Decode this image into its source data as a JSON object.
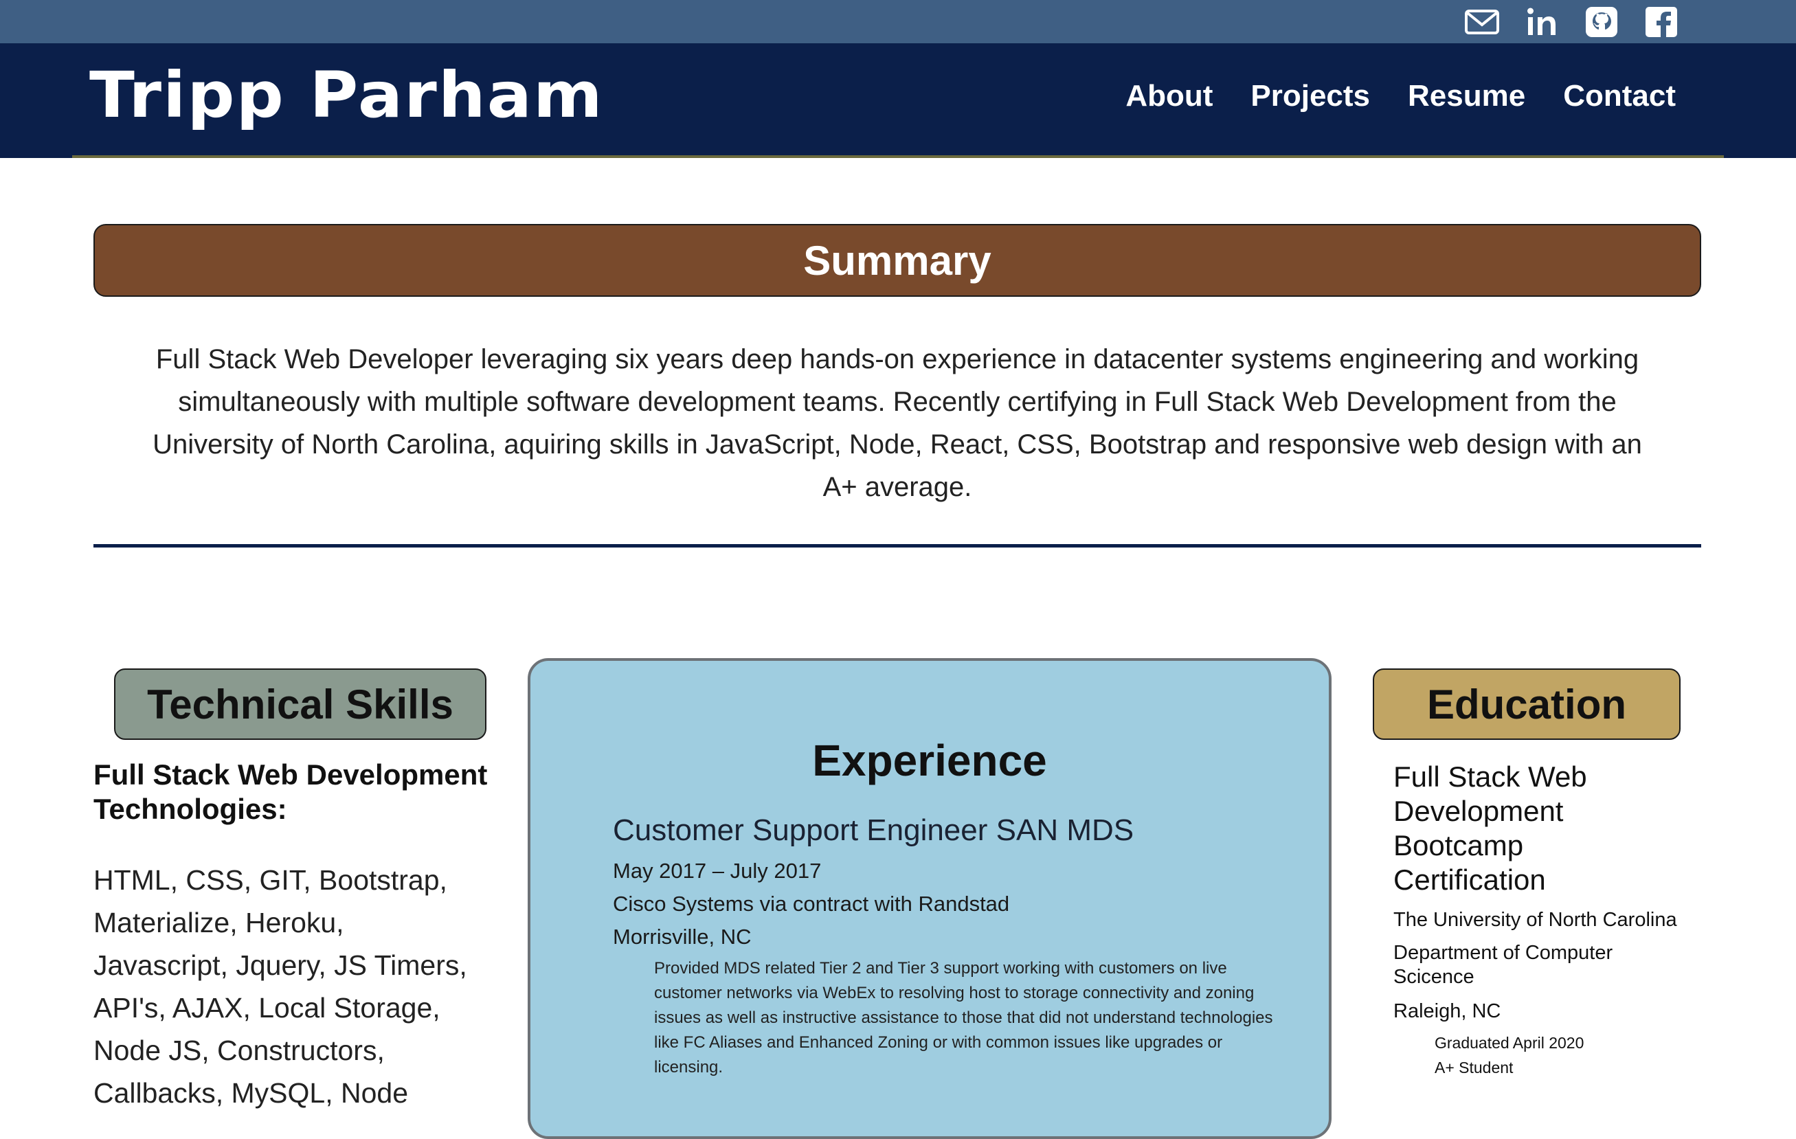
{
  "social": {
    "items": [
      {
        "name": "email-icon"
      },
      {
        "name": "linkedin-icon"
      },
      {
        "name": "github-icon"
      },
      {
        "name": "facebook-icon"
      }
    ]
  },
  "brand": "Tripp Parham",
  "nav": {
    "about": "About",
    "projects": "Projects",
    "resume": "Resume",
    "contact": "Contact"
  },
  "summary": {
    "heading": "Summary",
    "line1": "Full Stack Web Developer leveraging six years deep hands-on experience in datacenter systems engineering and working",
    "line2": "simultaneously with multiple software development teams. Recently certifying in Full Stack Web Development from the",
    "line3": "University of North Carolina, aquiring skills in JavaScript, Node, React, CSS, Bootstrap and responsive web design with an",
    "line4": "A+ average."
  },
  "skills": {
    "heading": "Technical Skills",
    "sub1": "Full Stack Web Development",
    "sub2": "Technologies:",
    "lines": [
      "HTML, CSS, GIT, Bootstrap,",
      "Materialize, Heroku,",
      "Javascript, Jquery, JS Timers,",
      "API's, AJAX, Local Storage,",
      "Node JS, Constructors,",
      "Callbacks, MySQL, Node"
    ]
  },
  "experience": {
    "heading": "Experience",
    "job_title": "Customer Support Engineer SAN MDS",
    "dates": "May 2017 – July 2017",
    "company": "Cisco Systems via contract with Randstad",
    "location": "Morrisville, NC",
    "desc_lines": [
      "Provided MDS related Tier 2 and Tier 3 support working with customers on live",
      "customer networks via WebEx to resolving host to storage connectivity and zoning",
      "issues as well as instructive assistance to those that did not understand technologies",
      "like FC Aliases and Enhanced Zoning or with common issues like upgrades or",
      "licensing."
    ]
  },
  "education": {
    "heading": "Education",
    "title_lines": [
      "Full Stack Web",
      "Development",
      "Bootcamp",
      "Certification"
    ],
    "school": "The University of North Carolina",
    "dept_line1": "Department of Computer",
    "dept_line2": "Scicence",
    "location": "Raleigh, NC",
    "graduated": "Graduated April 2020",
    "grade": "A+ Student"
  }
}
